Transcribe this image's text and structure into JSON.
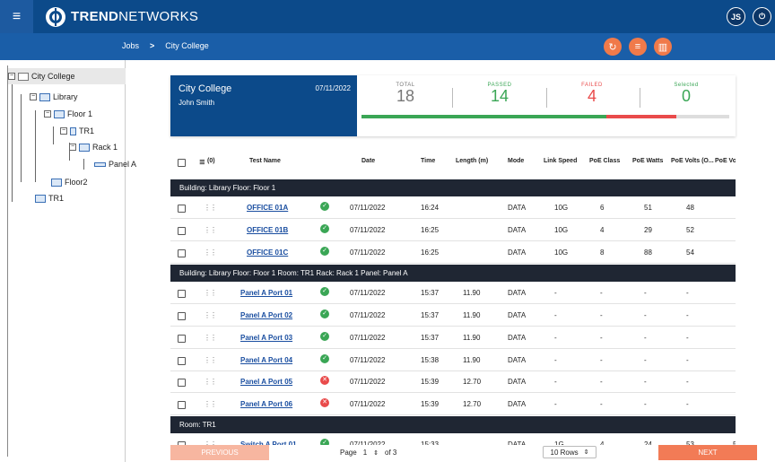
{
  "header": {
    "brand_bold": "TREND",
    "brand_light": " NETWORKS",
    "user_initials": "JS",
    "menu_icon": "≡",
    "power_icon": "⏻"
  },
  "breadcrumb": {
    "root": "Jobs",
    "sep": ">",
    "current": "City College"
  },
  "tools": {
    "refresh": "↻",
    "filter": "≡",
    "view": "▥"
  },
  "tree": [
    {
      "label": "City College"
    },
    {
      "label": "Library"
    },
    {
      "label": "Floor 1"
    },
    {
      "label": "TR1"
    },
    {
      "label": "Rack 1"
    },
    {
      "label": "Panel A"
    },
    {
      "label": "Floor2"
    },
    {
      "label": "TR1"
    }
  ],
  "summary": {
    "site": "City College",
    "user": "John Smith",
    "date": "07/11/2022",
    "total_label": "TOTAL",
    "total": "18",
    "passed_label": "PASSED",
    "passed": "14",
    "failed_label": "FAILED",
    "failed": "4",
    "selected_label": "Selected",
    "selected": "0",
    "pass_fraction": 0.666,
    "fail_fraction": 0.19,
    "colors": {
      "passed": "#3aa655",
      "failed": "#e94b4b",
      "primary": "#0c4a8a",
      "accent": "#f27b56"
    }
  },
  "table": {
    "select_count": "(0)",
    "headers": {
      "name": "Test Name",
      "date": "Date",
      "time": "Time",
      "length": "Length (m)",
      "mode": "Mode",
      "speed": "Link Speed",
      "poe_class": "PoE Class",
      "poe_watts": "PoE Watts",
      "poe_volts_o": "PoE Volts (O...",
      "poe_volt2": "PoE Volt"
    },
    "groups": [
      "Building: Library   Floor: Floor 1",
      "Building: Library   Floor: Floor 1   Room: TR1   Rack: Rack 1   Panel: Panel A",
      "Room: TR1"
    ],
    "rows": [
      {
        "name": "OFFICE 01A",
        "status": "pass",
        "date": "07/11/2022",
        "time": "16:24",
        "length": "",
        "mode": "DATA",
        "speed": "10G",
        "poe_class": "6",
        "poe_watts": "51",
        "poe_volts": "48"
      },
      {
        "name": "OFFICE 01B",
        "status": "pass",
        "date": "07/11/2022",
        "time": "16:25",
        "length": "",
        "mode": "DATA",
        "speed": "10G",
        "poe_class": "4",
        "poe_watts": "29",
        "poe_volts": "52"
      },
      {
        "name": "OFFICE 01C",
        "status": "pass",
        "date": "07/11/2022",
        "time": "16:25",
        "length": "",
        "mode": "DATA",
        "speed": "10G",
        "poe_class": "8",
        "poe_watts": "88",
        "poe_volts": "54"
      },
      {
        "name": "Panel A Port 01",
        "status": "pass",
        "date": "07/11/2022",
        "time": "15:37",
        "length": "11.90",
        "mode": "DATA",
        "speed": "-",
        "poe_class": "-",
        "poe_watts": "-",
        "poe_volts": "-"
      },
      {
        "name": "Panel A Port 02",
        "status": "pass",
        "date": "07/11/2022",
        "time": "15:37",
        "length": "11.90",
        "mode": "DATA",
        "speed": "-",
        "poe_class": "-",
        "poe_watts": "-",
        "poe_volts": "-"
      },
      {
        "name": "Panel A Port 03",
        "status": "pass",
        "date": "07/11/2022",
        "time": "15:37",
        "length": "11.90",
        "mode": "DATA",
        "speed": "-",
        "poe_class": "-",
        "poe_watts": "-",
        "poe_volts": "-"
      },
      {
        "name": "Panel A Port 04",
        "status": "pass",
        "date": "07/11/2022",
        "time": "15:38",
        "length": "11.90",
        "mode": "DATA",
        "speed": "-",
        "poe_class": "-",
        "poe_watts": "-",
        "poe_volts": "-"
      },
      {
        "name": "Panel A Port 05",
        "status": "fail",
        "date": "07/11/2022",
        "time": "15:39",
        "length": "12.70",
        "mode": "DATA",
        "speed": "-",
        "poe_class": "-",
        "poe_watts": "-",
        "poe_volts": "-"
      },
      {
        "name": "Panel A Port 06",
        "status": "fail",
        "date": "07/11/2022",
        "time": "15:39",
        "length": "12.70",
        "mode": "DATA",
        "speed": "-",
        "poe_class": "-",
        "poe_watts": "-",
        "poe_volts": "-"
      },
      {
        "name": "Switch A Port 01",
        "status": "pass",
        "date": "07/11/2022",
        "time": "15:33",
        "length": "",
        "mode": "DATA",
        "speed": "1G",
        "poe_class": "4",
        "poe_watts": "24",
        "poe_volts": "53",
        "poe_volts2": "55"
      }
    ]
  },
  "footer": {
    "prev": "PREVIOUS",
    "next": "NEXT",
    "page_label": "Page",
    "page": "1",
    "of": "of 3",
    "rows": "10 Rows"
  }
}
